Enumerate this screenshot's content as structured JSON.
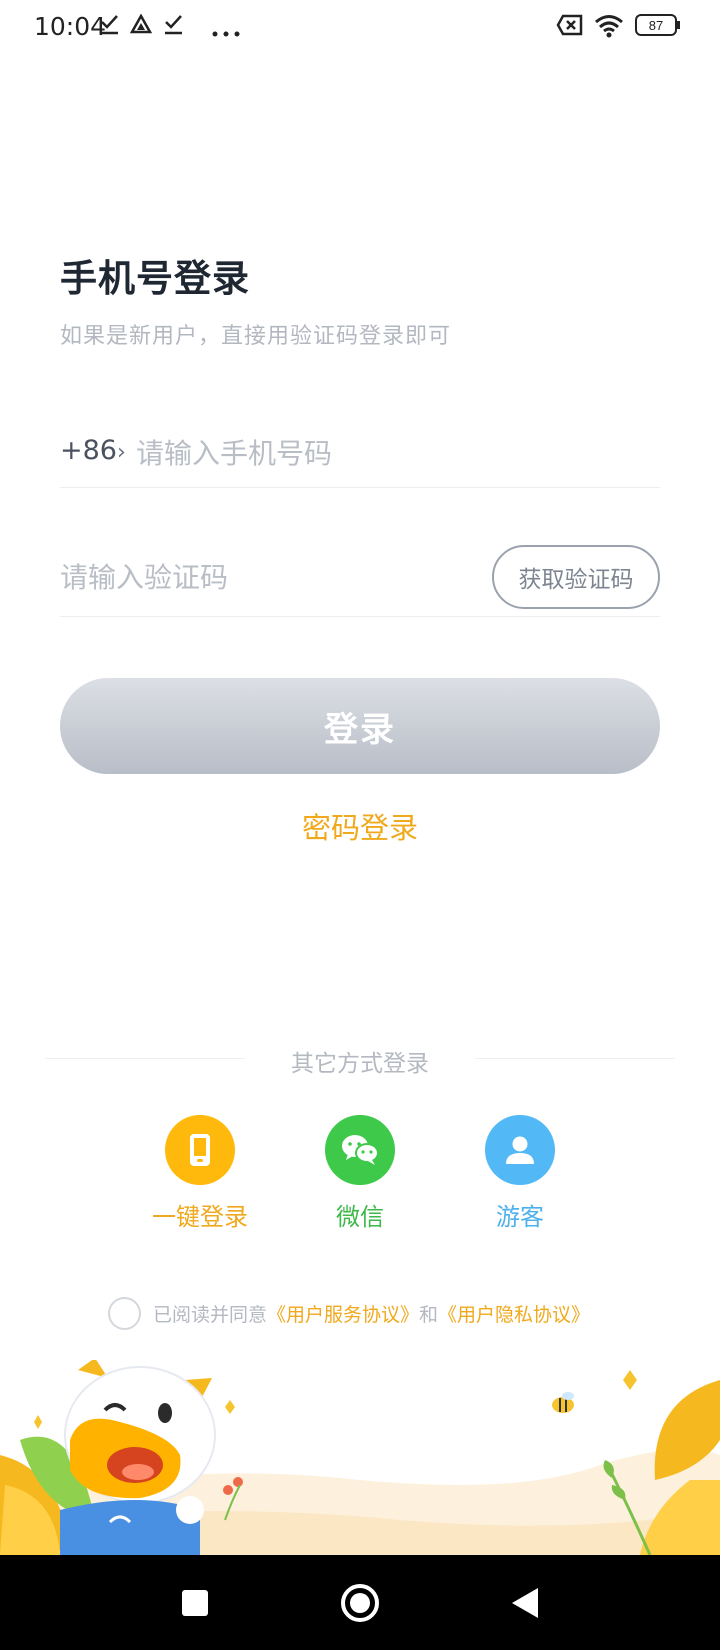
{
  "status_bar": {
    "time": "10:04",
    "battery": "87",
    "icons": [
      "check-icon",
      "drive-icon",
      "check-icon",
      "more-icon",
      "sim-off-icon",
      "wifi-icon",
      "battery-icon"
    ]
  },
  "header": {
    "title": "手机号登录",
    "subtitle": "如果是新用户，直接用验证码登录即可"
  },
  "phone": {
    "country_code": "+86",
    "placeholder": "请输入手机号码",
    "value": ""
  },
  "code": {
    "placeholder": "请输入验证码",
    "value": "",
    "get_code_label": "获取验证码"
  },
  "login_button": "登录",
  "password_login": "密码登录",
  "other_methods": {
    "title": "其它方式登录",
    "items": [
      {
        "label": "一键登录",
        "icon": "phone-icon",
        "color": "#ffb80c"
      },
      {
        "label": "微信",
        "icon": "wechat-icon",
        "color": "#3ec94a"
      },
      {
        "label": "游客",
        "icon": "user-icon",
        "color": "#52b8f6"
      }
    ]
  },
  "agreement": {
    "prefix": "已阅读并同意",
    "service_link": "《用户服务协议》",
    "and": "和",
    "privacy_link": "《用户隐私协议》",
    "checked": false
  },
  "colors": {
    "accent": "#f0a91c",
    "login_disabled_top": "#dcdfe4",
    "login_disabled_bottom": "#b8bec8",
    "wechat": "#3ec94a",
    "guest": "#52b8f6"
  }
}
